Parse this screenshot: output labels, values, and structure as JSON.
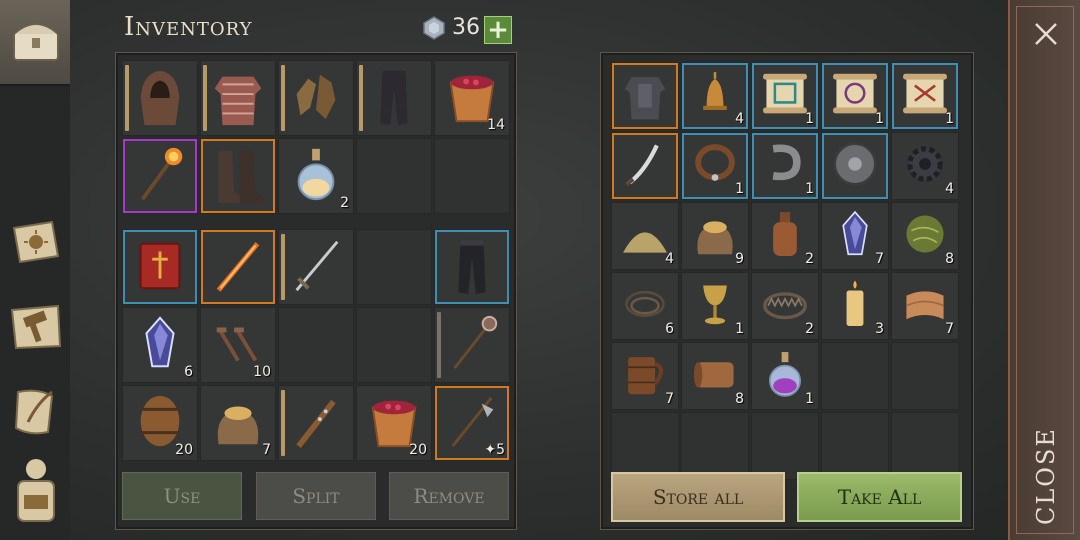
{
  "header": {
    "title": "Inventory",
    "currency_value": "36",
    "add_label": "+"
  },
  "inventory_grid_top": [
    {
      "item": "hood",
      "bar": "#b89a68"
    },
    {
      "item": "chainmail-shirt",
      "bar": "#b89a68"
    },
    {
      "item": "leather-gloves",
      "bar": "#b89a68"
    },
    {
      "item": "leather-pants",
      "bar": "#b89a68"
    },
    {
      "item": "bucket-of-berries",
      "count": "14"
    },
    {
      "item": "flaming-mace",
      "frame": "purple"
    },
    {
      "item": "leather-boots",
      "frame": "orange"
    },
    {
      "item": "potion-flask",
      "count": "2"
    },
    {
      "item": "empty"
    },
    {
      "item": "empty"
    }
  ],
  "inventory_grid_bottom": [
    {
      "item": "red-book",
      "frame": "blue"
    },
    {
      "item": "flaming-sword",
      "frame": "orange"
    },
    {
      "item": "steel-sword",
      "bar": "#b89a68"
    },
    {
      "item": "empty"
    },
    {
      "item": "dark-pants",
      "frame": "blue"
    },
    {
      "item": "crystal",
      "count": "6"
    },
    {
      "item": "nails",
      "count": "10"
    },
    {
      "item": "empty"
    },
    {
      "item": "empty"
    },
    {
      "item": "spiked-mace",
      "bar": "#7a7468"
    },
    {
      "item": "barrel",
      "count": "20"
    },
    {
      "item": "sack-of-grain",
      "count": "7"
    },
    {
      "item": "spiked-club",
      "bar": "#b89a68"
    },
    {
      "item": "bucket-of-berries",
      "count": "20"
    },
    {
      "item": "halberd",
      "frame": "orange",
      "count": "5",
      "count_prefix": "✦"
    }
  ],
  "buttons": {
    "use": "Use",
    "split": "Split",
    "remove": "Remove",
    "store_all": "Store all",
    "take_all": "Take All",
    "close": "CLOSE"
  },
  "storage_grid": [
    {
      "item": "plate-armor",
      "frame": "orange"
    },
    {
      "item": "bell",
      "count": "4",
      "frame": "blue"
    },
    {
      "item": "scroll-teal",
      "count": "1",
      "frame": "blue"
    },
    {
      "item": "scroll-purple",
      "count": "1",
      "frame": "blue"
    },
    {
      "item": "scroll-red",
      "count": "1",
      "frame": "blue"
    },
    {
      "item": "curved-blade",
      "frame": "orange"
    },
    {
      "item": "collar",
      "count": "1",
      "frame": "blue"
    },
    {
      "item": "iron-bracket",
      "count": "1",
      "frame": "blue"
    },
    {
      "item": "round-shield",
      "frame": "blue"
    },
    {
      "item": "gear-part",
      "count": "4"
    },
    {
      "item": "sand-pile",
      "count": "4"
    },
    {
      "item": "sack-of-grain",
      "count": "9"
    },
    {
      "item": "clay-bottle",
      "count": "2"
    },
    {
      "item": "crystal",
      "count": "7"
    },
    {
      "item": "grass-ball",
      "count": "8"
    },
    {
      "item": "rope",
      "count": "6"
    },
    {
      "item": "goblet",
      "count": "1"
    },
    {
      "item": "bear-trap",
      "count": "2"
    },
    {
      "item": "candle",
      "count": "3"
    },
    {
      "item": "cloth",
      "count": "7"
    },
    {
      "item": "wooden-mug",
      "count": "7"
    },
    {
      "item": "leather-roll",
      "count": "8"
    },
    {
      "item": "purple-potion",
      "count": "1"
    },
    {
      "item": "empty"
    },
    {
      "item": "empty"
    },
    {
      "item": "empty"
    },
    {
      "item": "empty"
    },
    {
      "item": "empty"
    },
    {
      "item": "empty"
    },
    {
      "item": "empty"
    }
  ],
  "colors": {
    "frame_orange": "#d37a1f",
    "frame_blue": "#3f8fb5",
    "frame_purple": "#a63ac7",
    "take_all_green": "#8aad5a",
    "store_all_tan": "#ab9772"
  }
}
